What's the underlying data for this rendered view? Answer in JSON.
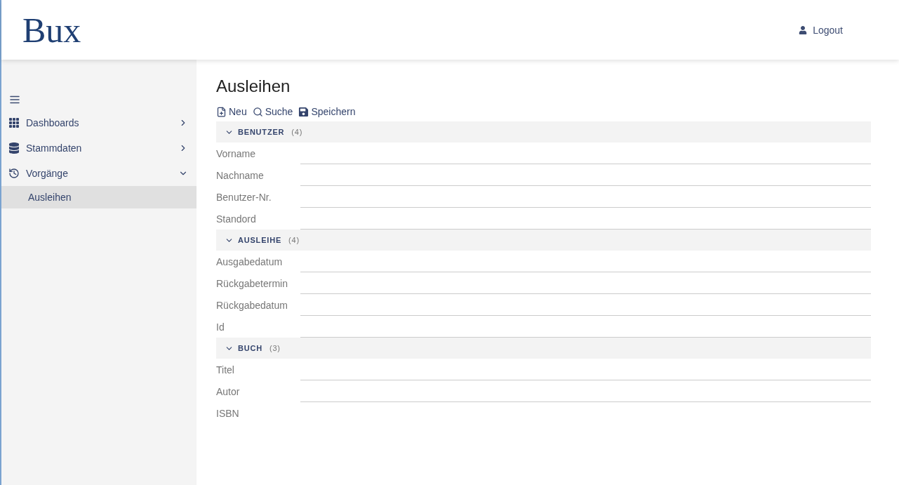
{
  "header": {
    "logo": "Bux",
    "logout": "Logout"
  },
  "sidebar": {
    "items": [
      {
        "label": "Dashboards",
        "expanded": false,
        "selected": false
      },
      {
        "label": "Stammdaten",
        "expanded": false,
        "selected": false
      },
      {
        "label": "Vorgänge",
        "expanded": true,
        "selected": false,
        "children": [
          {
            "label": "Ausleihen",
            "selected": true
          }
        ]
      }
    ]
  },
  "page": {
    "title": "Ausleihen",
    "toolbar": [
      {
        "label": "Neu"
      },
      {
        "label": "Suche"
      },
      {
        "label": "Speichern"
      }
    ],
    "sections": [
      {
        "title": "BENUTZER",
        "count": "(4)",
        "expanded": true,
        "fields": [
          {
            "label": "Vorname",
            "input": true
          },
          {
            "label": "Nachname",
            "input": true
          },
          {
            "label": "Benutzer-Nr.",
            "input": true
          },
          {
            "label": "Standord",
            "input": true
          }
        ]
      },
      {
        "title": "AUSLEIHE",
        "count": "(4)",
        "expanded": true,
        "fields": [
          {
            "label": "Ausgabedatum",
            "input": true
          },
          {
            "label": "Rückgabetermin",
            "input": true
          },
          {
            "label": "Rückgabedatum",
            "input": true
          },
          {
            "label": "Id",
            "input": true
          }
        ]
      },
      {
        "title": "BUCH",
        "count": "(3)",
        "expanded": true,
        "fields": [
          {
            "label": "Titel",
            "input": true
          },
          {
            "label": "Autor",
            "input": true
          },
          {
            "label": "ISBN",
            "input": false
          }
        ]
      }
    ]
  }
}
